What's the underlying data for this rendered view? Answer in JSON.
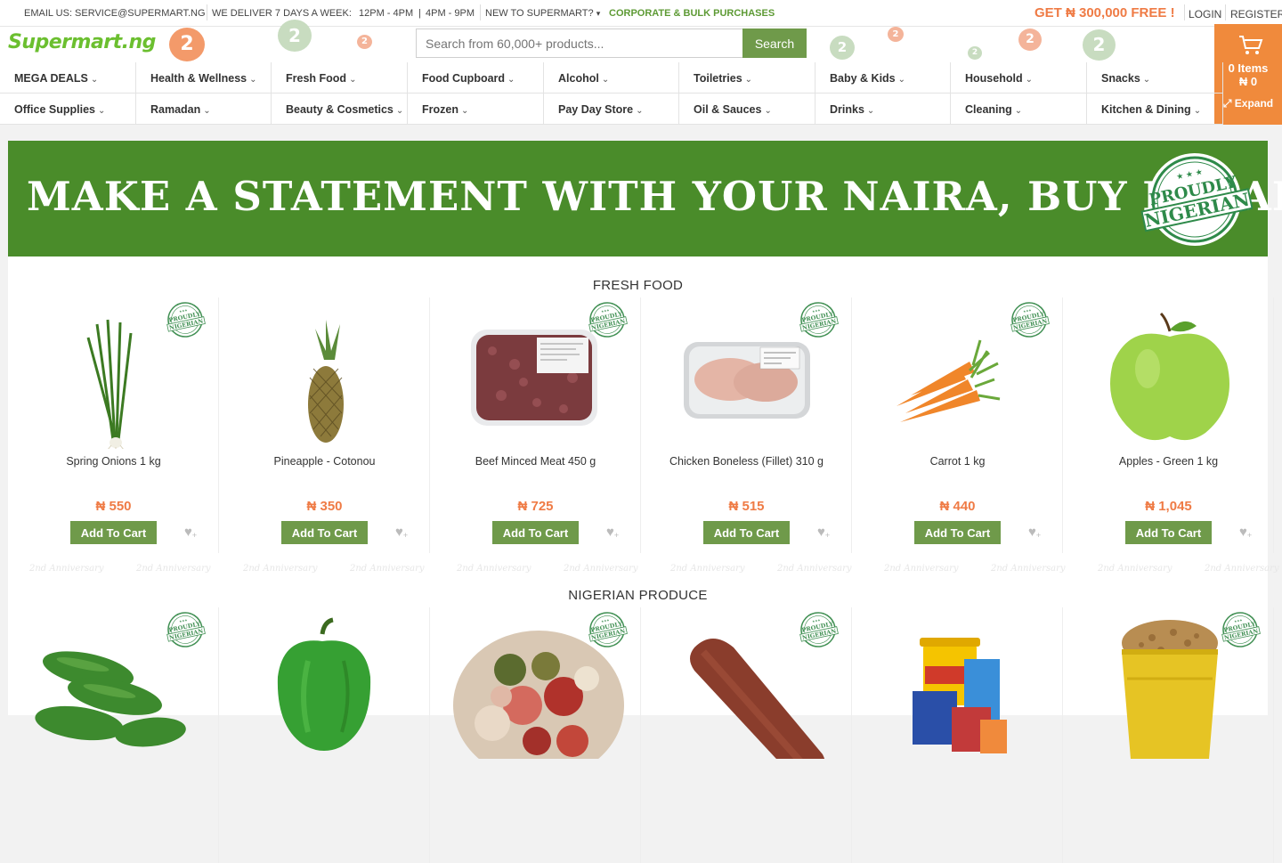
{
  "topbar": {
    "email": "EMAIL US: SERVICE@SUPERMART.NG",
    "deliver": "WE DELIVER 7 DAYS A WEEK:",
    "slot1": "12PM - 4PM",
    "slot_sep": "|",
    "slot2": "4PM - 9PM",
    "new": "NEW TO SUPERMART?",
    "new_caret": "▾",
    "corporate": "CORPORATE & BULK PURCHASES",
    "promo": "GET ₦ 300,000 FREE !",
    "login": "LOGIN",
    "register": "REGISTER"
  },
  "header": {
    "logo": "Supermart.ng",
    "balloon_text": "2",
    "search_placeholder": "Search from 60,000+ products...",
    "search_label": "Search"
  },
  "cart": {
    "items": "0 Items",
    "amount": "₦ 0",
    "expand": "⤢ Expand"
  },
  "nav": {
    "row1": [
      "MEGA DEALS",
      "Health & Wellness",
      "Fresh Food",
      "Food Cupboard",
      "Alcohol",
      "Toiletries",
      "Baby & Kids",
      "Household",
      "Snacks"
    ],
    "row2": [
      "Office Supplies",
      "Ramadan",
      "Beauty & Cosmetics",
      "Frozen",
      "Pay Day Store",
      "Oil & Sauces",
      "Drinks",
      "Cleaning",
      "Kitchen & Dining"
    ],
    "caret": "⌄"
  },
  "banner": {
    "text": "MAKE A STATEMENT WITH YOUR NAIRA, BUY LOCAL",
    "stamp_line1": "PROUDLY",
    "stamp_line2": "NIGERIAN",
    "stamp_stars": "★ ★ ★"
  },
  "badge": {
    "line1": "PROUDLY",
    "line2": "NIGERIAN",
    "stars": "★★★"
  },
  "watermark": "2nd Anniversary",
  "sections": [
    {
      "title": "FRESH FOOD",
      "products": [
        {
          "name": "Spring Onions 1 kg",
          "price": "₦ 550",
          "badge": true
        },
        {
          "name": "Pineapple - Cotonou",
          "price": "₦ 350",
          "badge": false
        },
        {
          "name": "Beef Minced Meat 450 g",
          "price": "₦ 725",
          "badge": true
        },
        {
          "name": "Chicken Boneless (Fillet) 310 g",
          "price": "₦ 515",
          "badge": true
        },
        {
          "name": "Carrot 1 kg",
          "price": "₦ 440",
          "badge": true
        },
        {
          "name": "Apples - Green 1 kg",
          "price": "₦ 1,045",
          "badge": false
        }
      ]
    },
    {
      "title": "NIGERIAN PRODUCE",
      "products": [
        {
          "badge": true
        },
        {
          "badge": false
        },
        {
          "badge": true
        },
        {
          "badge": true
        },
        {
          "badge": false
        },
        {
          "badge": true
        }
      ]
    }
  ],
  "labels": {
    "add_to_cart": "Add To Cart",
    "wishlist": "♥",
    "wishlist_plus": "+"
  },
  "colors": {
    "brand_green": "#4a8c2a",
    "button_green": "#6f9a4a",
    "accent_orange": "#ef7b45",
    "cart_orange": "#f08a3c"
  }
}
